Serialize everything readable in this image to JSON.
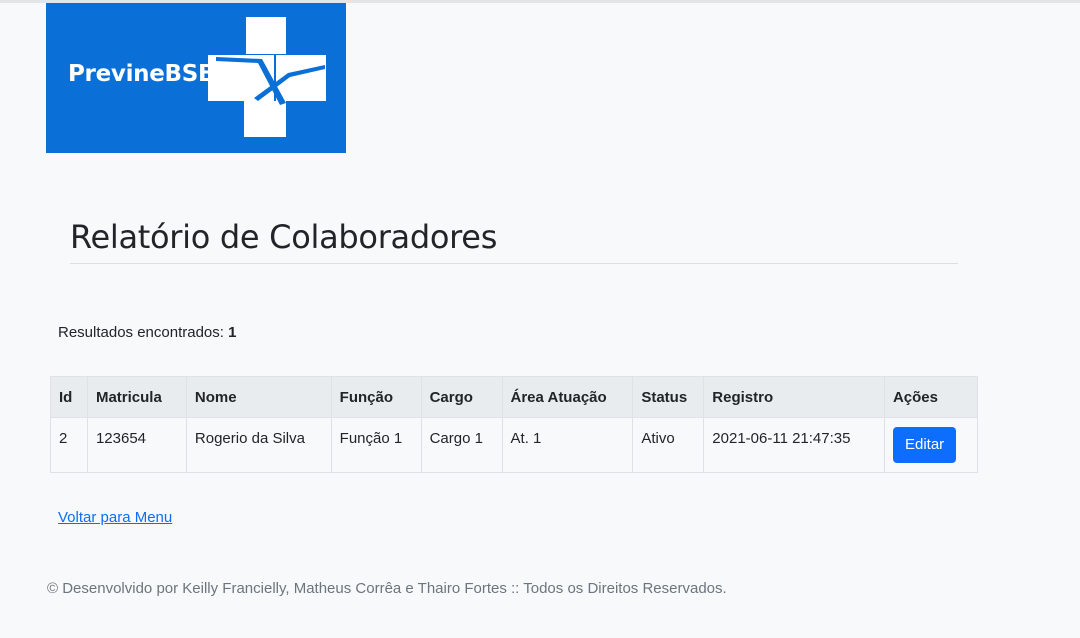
{
  "logo": {
    "text": "PrevineBSB",
    "color": "#0a6fd6"
  },
  "page": {
    "title": "Relatório de Colaboradores"
  },
  "results": {
    "label": "Resultados encontrados:",
    "count": "1"
  },
  "table": {
    "headers": [
      "Id",
      "Matricula",
      "Nome",
      "Função",
      "Cargo",
      "Área Atuação",
      "Status",
      "Registro",
      "Ações"
    ],
    "rows": [
      {
        "id": "2",
        "matricula": "123654",
        "nome": "Rogerio da Silva",
        "funcao": "Função 1",
        "cargo": "Cargo 1",
        "area": "At. 1",
        "status": "Ativo",
        "registro": "2021-06-11 21:47:35",
        "action_label": "Editar"
      }
    ]
  },
  "nav": {
    "back_label": "Voltar para Menu"
  },
  "footer": {
    "text": "© Desenvolvido por Keilly Francielly, Matheus Corrêa e Thairo Fortes :: Todos os Direitos Reservados."
  },
  "colors": {
    "primary": "#0d6efd",
    "header_bg": "#e9ecef",
    "muted": "#6c757d"
  }
}
